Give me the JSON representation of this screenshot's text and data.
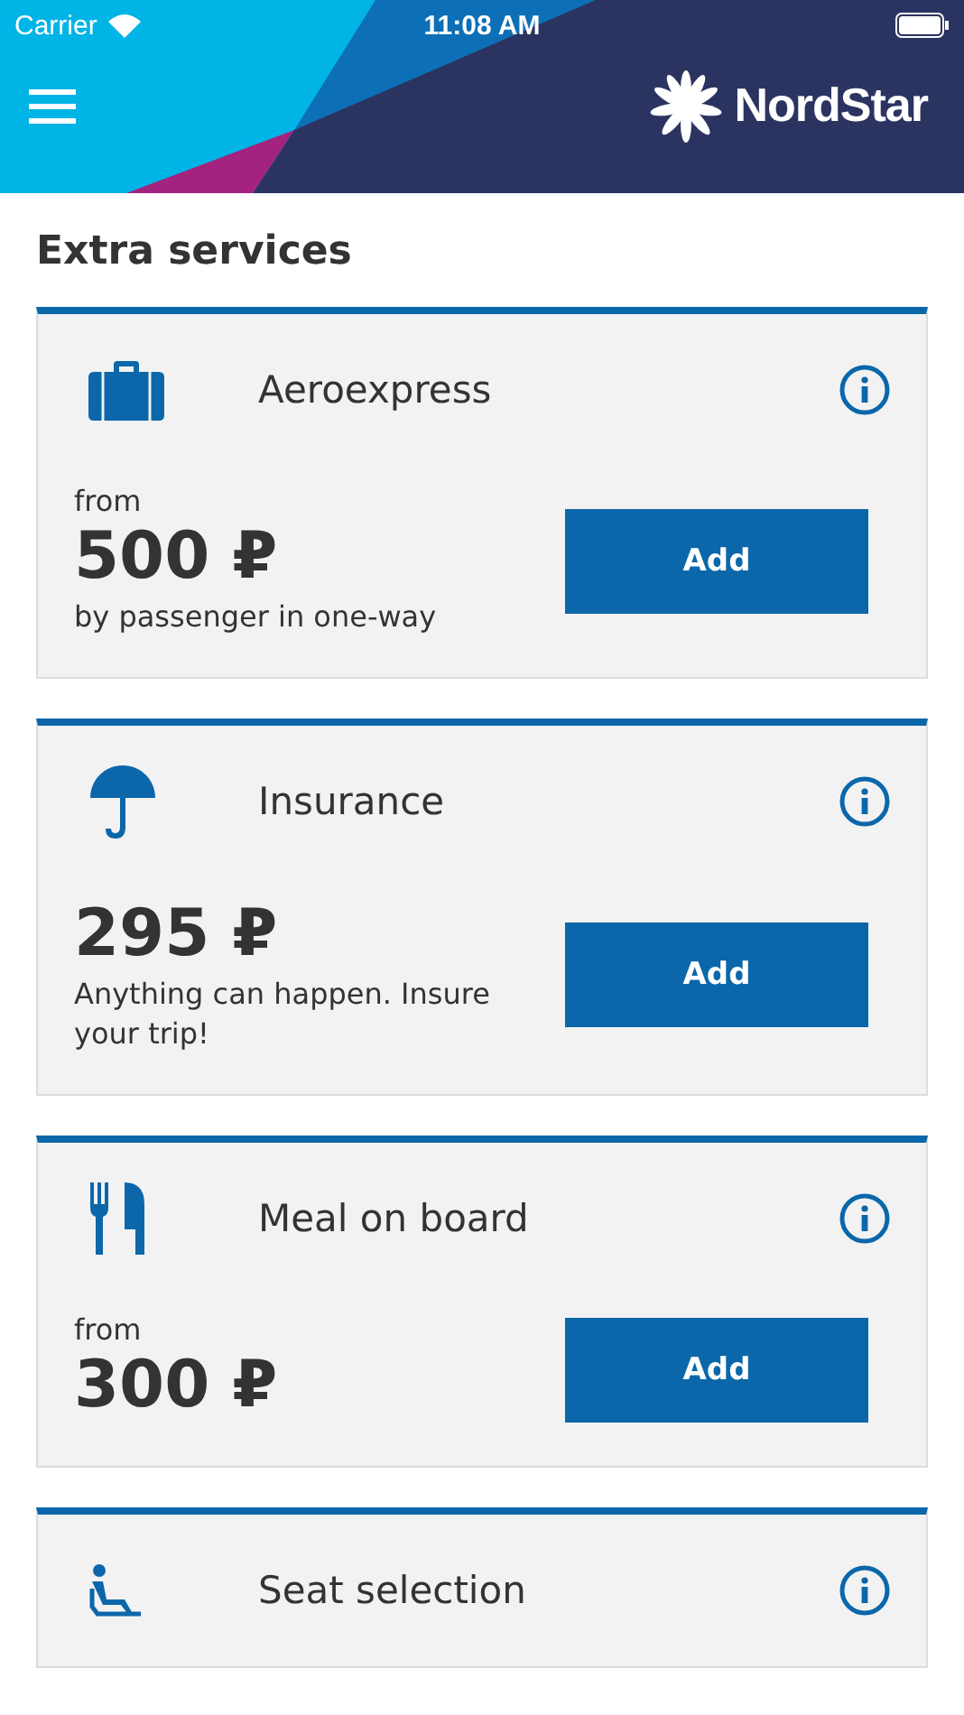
{
  "status_bar": {
    "carrier": "Carrier",
    "time": "11:08 AM"
  },
  "header": {
    "logo_text": "NordStar"
  },
  "title": "Extra services",
  "services": [
    {
      "kind": "suitcase",
      "name": "Aeroexpress",
      "from": "from",
      "price": "500 ₽",
      "note": "by passenger in one-way",
      "button": "Add"
    },
    {
      "kind": "umbrella",
      "name": "Insurance",
      "price": "295 ₽",
      "note": "Anything can happen. Insure your trip!",
      "button": "Add"
    },
    {
      "kind": "cutlery",
      "name": "Meal on board",
      "from": "from",
      "price": "300 ₽",
      "button": "Add"
    },
    {
      "kind": "seat",
      "name": "Seat selection"
    }
  ]
}
